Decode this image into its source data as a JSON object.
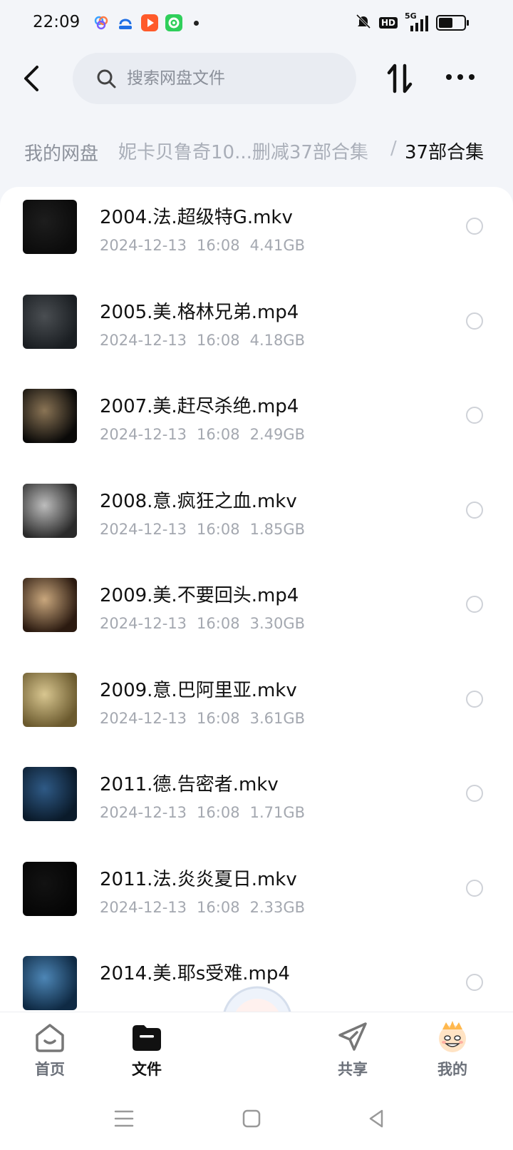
{
  "status_bar": {
    "time": "22:09",
    "apps": [
      "cloud-drive-icon",
      "baidu-icon",
      "video-app-icon",
      "green-app-icon"
    ],
    "hd_label": "HD",
    "network_label": "5G",
    "battery_percent": 55
  },
  "header": {
    "search_placeholder": "搜索网盘文件"
  },
  "breadcrumb": {
    "root": "我的网盘",
    "parent": "妮卡贝鲁奇10...删减37部合集",
    "separator": "/",
    "current": "37部合集"
  },
  "files": [
    {
      "name": "2004.法.超级特G.mkv",
      "date": "2024-12-13",
      "time": "16:08",
      "size": "4.41GB",
      "thumb_colors": [
        "#0b0b0b",
        "#1d1d1d"
      ]
    },
    {
      "name": "2005.美.格林兄弟.mp4",
      "date": "2024-12-13",
      "time": "16:08",
      "size": "4.18GB",
      "thumb_colors": [
        "#1a1e22",
        "#4a4e52"
      ]
    },
    {
      "name": "2007.美.赶尽杀绝.mp4",
      "date": "2024-12-13",
      "time": "16:08",
      "size": "2.49GB",
      "thumb_colors": [
        "#0a0908",
        "#8a7455"
      ]
    },
    {
      "name": "2008.意.疯狂之血.mkv",
      "date": "2024-12-13",
      "time": "16:08",
      "size": "1.85GB",
      "thumb_colors": [
        "#2a2a2a",
        "#bdbdbd"
      ]
    },
    {
      "name": "2009.美.不要回头.mp4",
      "date": "2024-12-13",
      "time": "16:08",
      "size": "3.30GB",
      "thumb_colors": [
        "#2b1a10",
        "#c9a77d"
      ]
    },
    {
      "name": "2009.意.巴阿里亚.mkv",
      "date": "2024-12-13",
      "time": "16:08",
      "size": "3.61GB",
      "thumb_colors": [
        "#6b5a2e",
        "#d8c690"
      ]
    },
    {
      "name": "2011.德.告密者.mkv",
      "date": "2024-12-13",
      "time": "16:08",
      "size": "1.71GB",
      "thumb_colors": [
        "#0a1a2a",
        "#2f5a86"
      ]
    },
    {
      "name": "2011.法.炎炎夏日.mkv",
      "date": "2024-12-13",
      "time": "16:08",
      "size": "2.33GB",
      "thumb_colors": [
        "#050505",
        "#121212"
      ]
    },
    {
      "name": "2014.美.耶s受难.mp4",
      "date": "",
      "time": "",
      "size": "",
      "thumb_colors": [
        "#0f2a44",
        "#4d86b6"
      ]
    }
  ],
  "tabs": [
    {
      "label": "首页",
      "icon": "home-face-icon",
      "active": false
    },
    {
      "label": "文件",
      "icon": "folder-icon",
      "active": true
    },
    {
      "label": "共享",
      "icon": "share-plane-icon",
      "active": false
    },
    {
      "label": "我的",
      "icon": "profile-avatar-icon",
      "active": false
    }
  ],
  "colors": {
    "background": "#f3f5f9",
    "panel": "#ffffff",
    "meta_text": "#a4a8b0",
    "accent_active": "#111111"
  }
}
